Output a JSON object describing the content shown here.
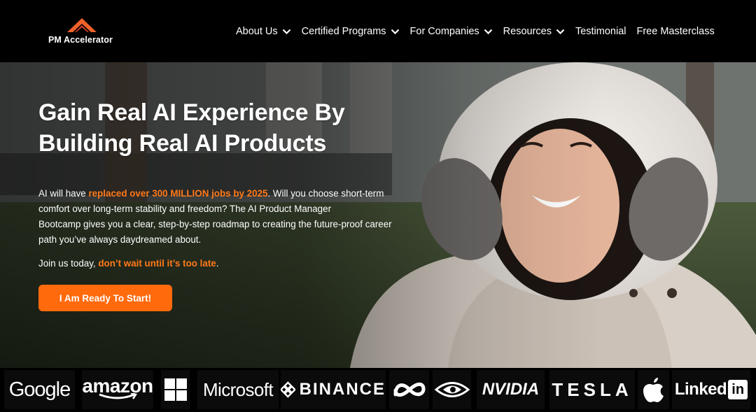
{
  "brand": {
    "name": "PM Accelerator",
    "accent": "#ff6a0d"
  },
  "nav": {
    "items": [
      {
        "label": "About Us",
        "has_dropdown": true
      },
      {
        "label": "Certified Programs",
        "has_dropdown": true
      },
      {
        "label": "For Companies",
        "has_dropdown": true
      },
      {
        "label": "Resources",
        "has_dropdown": true
      },
      {
        "label": "Testimonial",
        "has_dropdown": false
      },
      {
        "label": "Free Masterclass",
        "has_dropdown": false
      }
    ]
  },
  "hero": {
    "title_line1": "Gain Real AI Experience By",
    "title_line2": "Building Real AI Products",
    "body_prefix": "AI will have ",
    "body_highlight": "replaced over 300 MILLION jobs by 2025",
    "body_line1_rest": ". Will you choose short-term",
    "body_line2": "comfort over long-term stability and freedom? The AI Product Manager",
    "body_line3": "Bootcamp gives you a clear, step-by-step roadmap to creating the future-proof career",
    "body_line4": "path you’ve always daydreamed about.",
    "join_prefix": "Join us today, ",
    "join_highlight": "don’t wait until it’s too late",
    "join_suffix": ".",
    "cta_label": "I Am Ready To Start!",
    "highlight_color": "#ff7a1a"
  },
  "logos": {
    "google": "Google",
    "amazon": "amazon",
    "microsoft": "Microsoft",
    "binance": "BINANCE",
    "nvidia": "NVIDIA",
    "tesla": "TESLA",
    "linkedin": "Linked",
    "linkedin_box": "in",
    "icons": [
      "windows-icon",
      "meta-icon",
      "nvidia-eye-icon",
      "apple-icon",
      "binance-icon"
    ]
  }
}
